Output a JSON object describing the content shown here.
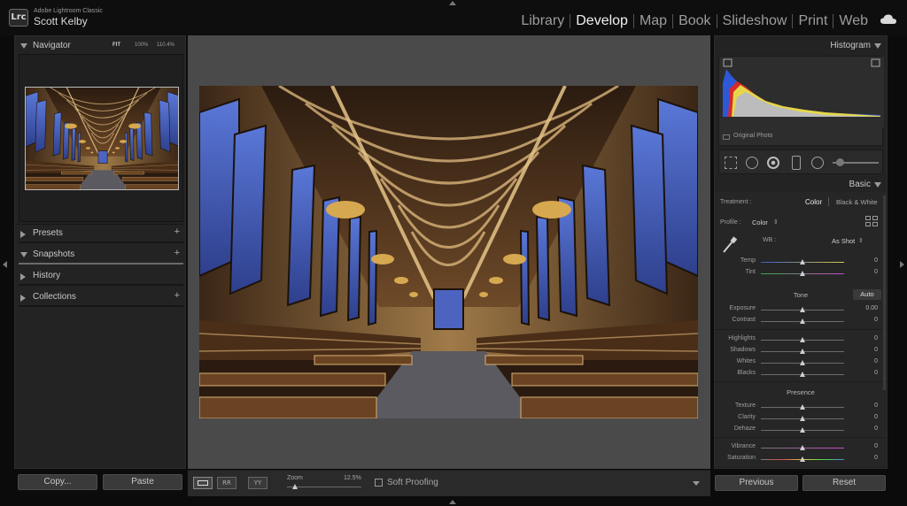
{
  "app": {
    "logo": "Lrc",
    "name": "Adobe Lightroom Classic",
    "user": "Scott Kelby"
  },
  "modules": [
    {
      "label": "Library",
      "active": false
    },
    {
      "label": "Develop",
      "active": true
    },
    {
      "label": "Map",
      "active": false
    },
    {
      "label": "Book",
      "active": false
    },
    {
      "label": "Slideshow",
      "active": false
    },
    {
      "label": "Print",
      "active": false
    },
    {
      "label": "Web",
      "active": false
    }
  ],
  "navigator": {
    "title": "Navigator",
    "zoom_options": [
      "FIT",
      "100%",
      "110.4%"
    ]
  },
  "left_sections": [
    {
      "label": "Presets",
      "has_plus": true
    },
    {
      "label": "Snapshots",
      "has_plus": true
    },
    {
      "label": "History",
      "has_plus": false
    },
    {
      "label": "Collections",
      "has_plus": true
    }
  ],
  "left_buttons": {
    "copy": "Copy...",
    "paste": "Paste"
  },
  "histogram": {
    "title": "Histogram",
    "original_photo": "Original Photo"
  },
  "basic": {
    "title": "Basic",
    "treatment_label": "Treatment :",
    "treatment_color": "Color",
    "treatment_bw": "Black & White",
    "profile_label": "Profile :",
    "profile_value": "Color",
    "wb_label": "WB :",
    "wb_value": "As Shot",
    "tone_label": "Tone",
    "auto_label": "Auto",
    "presence_label": "Presence",
    "wb_sliders": [
      {
        "label": "Temp",
        "value": "0"
      },
      {
        "label": "Tint",
        "value": "0"
      }
    ],
    "tone_sliders_a": [
      {
        "label": "Exposure",
        "value": "0.00"
      },
      {
        "label": "Contrast",
        "value": "0"
      }
    ],
    "tone_sliders_b": [
      {
        "label": "Highlights",
        "value": "0"
      },
      {
        "label": "Shadows",
        "value": "0"
      },
      {
        "label": "Whites",
        "value": "0"
      },
      {
        "label": "Blacks",
        "value": "0"
      }
    ],
    "presence_sliders_a": [
      {
        "label": "Texture",
        "value": "0"
      },
      {
        "label": "Clarity",
        "value": "0"
      },
      {
        "label": "Dehaze",
        "value": "0"
      }
    ],
    "presence_sliders_b": [
      {
        "label": "Vibrance",
        "value": "0"
      },
      {
        "label": "Saturation",
        "value": "0"
      }
    ]
  },
  "right_buttons": {
    "previous": "Previous",
    "reset": "Reset"
  },
  "toolbar": {
    "zoom_label": "Zoom",
    "zoom_value": "12.5%",
    "soft_proofing": "Soft Proofing"
  },
  "colors": {
    "accent": "#f0f0f0",
    "panel": "#232323",
    "canvas": "#4a4a4a"
  }
}
